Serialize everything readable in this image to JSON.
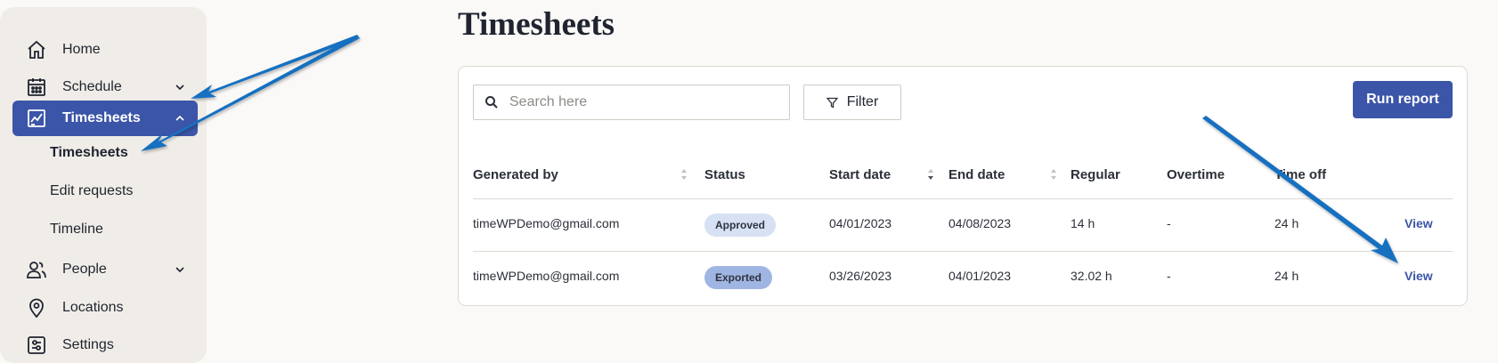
{
  "colors": {
    "accent": "#3b55a8",
    "sidebar_bg": "#f0ede8",
    "approved": "#d6e1f3",
    "exported": "#9fb5e2",
    "annotation_arrow": "#1570c0"
  },
  "sidebar": {
    "items": [
      {
        "label": "Home",
        "icon": "home-icon"
      },
      {
        "label": "Schedule",
        "icon": "calendar-icon"
      },
      {
        "label": "Timesheets",
        "icon": "chart-line-icon"
      },
      {
        "label": "People",
        "icon": "people-icon"
      },
      {
        "label": "Locations",
        "icon": "location-pin-icon"
      },
      {
        "label": "Settings",
        "icon": "settings-icon"
      }
    ],
    "sub_items": [
      "Timesheets",
      "Edit requests",
      "Timeline"
    ]
  },
  "page": {
    "title": "Timesheets"
  },
  "toolbar": {
    "search_placeholder": "Search here",
    "filter_label": "Filter",
    "run_report_label": "Run report"
  },
  "table": {
    "headers": [
      "Generated by",
      "Status",
      "Start date",
      "End date",
      "Regular",
      "Overtime",
      "Time off"
    ],
    "rows": [
      {
        "generated_by": "timeWPDemo@gmail.com",
        "status": "Approved",
        "start": "04/01/2023",
        "end": "04/08/2023",
        "regular": "14 h",
        "overtime": "-",
        "time_off": "24 h",
        "action": "View"
      },
      {
        "generated_by": "timeWPDemo@gmail.com",
        "status": "Exported",
        "start": "03/26/2023",
        "end": "04/01/2023",
        "regular": "32.02 h",
        "overtime": "-",
        "time_off": "24 h",
        "action": "View"
      }
    ]
  }
}
